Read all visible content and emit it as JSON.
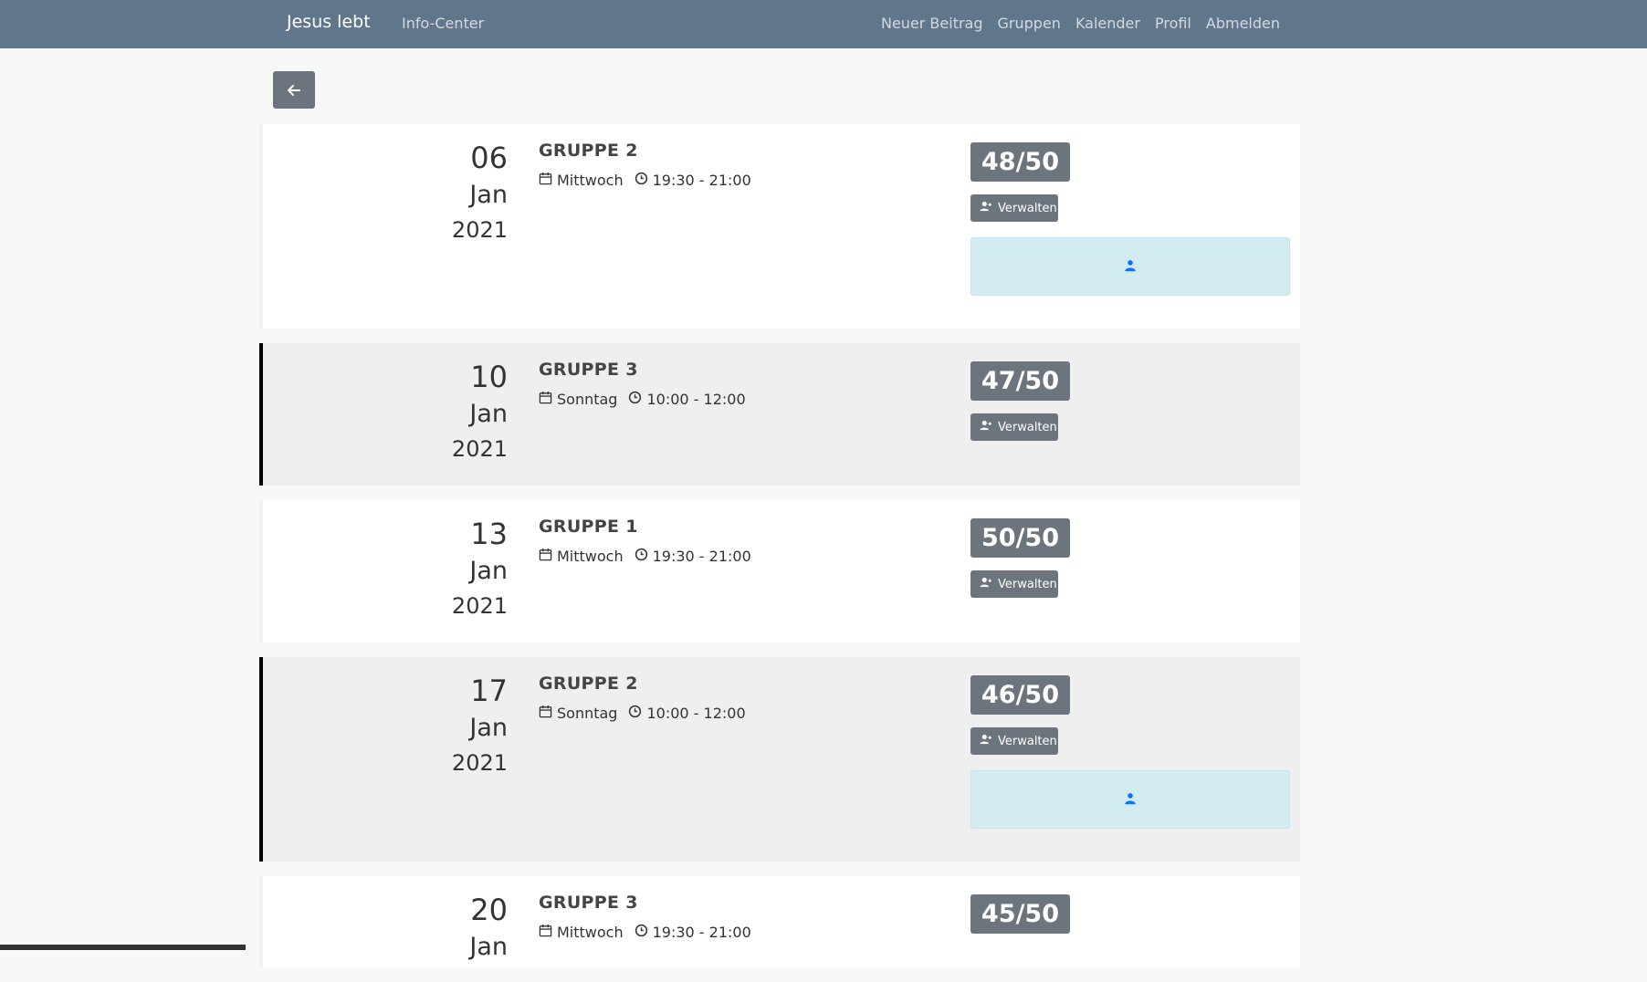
{
  "nav": {
    "brand": "Jesus lebt",
    "left_link": "Info-Center",
    "right_links": [
      "Neuer Beitrag",
      "Gruppen",
      "Kalender",
      "Profil",
      "Abmelden"
    ]
  },
  "back_icon": "arrow-left-icon",
  "manage_label": "Verwalten",
  "events": [
    {
      "day": "06",
      "month": "Jan",
      "year": "2021",
      "group": "GRUPPE 2",
      "weekday": "Mittwoch",
      "time": "19:30 - 21:00",
      "count": "48/50",
      "has_person": true,
      "shaded": false
    },
    {
      "day": "10",
      "month": "Jan",
      "year": "2021",
      "group": "GRUPPE 3",
      "weekday": "Sonntag",
      "time": "10:00 - 12:00",
      "count": "47/50",
      "has_person": false,
      "shaded": true
    },
    {
      "day": "13",
      "month": "Jan",
      "year": "2021",
      "group": "GRUPPE 1",
      "weekday": "Mittwoch",
      "time": "19:30 - 21:00",
      "count": "50/50",
      "has_person": false,
      "shaded": false
    },
    {
      "day": "17",
      "month": "Jan",
      "year": "2021",
      "group": "GRUPPE 2",
      "weekday": "Sonntag",
      "time": "10:00 - 12:00",
      "count": "46/50",
      "has_person": true,
      "shaded": true
    },
    {
      "day": "20",
      "month": "Jan",
      "year": "",
      "group": "GRUPPE 3",
      "weekday": "Mittwoch",
      "time": "19:30 - 21:00",
      "count": "45/50",
      "has_person": false,
      "shaded": false
    }
  ],
  "colors": {
    "navbar": "#5f768b",
    "badge": "#6c757d",
    "info_box": "#d1ebf1",
    "person_icon": "#0d6efd"
  }
}
